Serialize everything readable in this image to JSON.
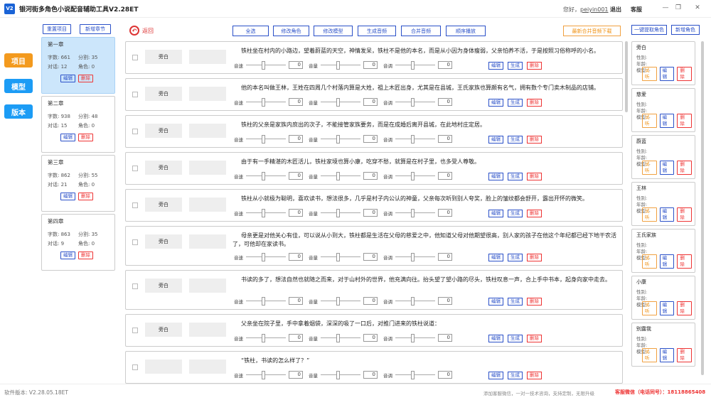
{
  "app": {
    "logo": "V2",
    "title": "银河街多角色小说配音辅助工具V2.28ET",
    "greeting": "您好，",
    "username": "peiyin001",
    "logout": "退出",
    "service": "客服"
  },
  "nav": {
    "items": [
      {
        "label": "项目",
        "color": "#f39a1e"
      },
      {
        "label": "模型",
        "color": "#1c9cf5"
      },
      {
        "label": "版本",
        "color": "#1c9cf5"
      }
    ]
  },
  "chapter_panel": {
    "reset": "重置项目",
    "add": "新增章节",
    "chapters": [
      {
        "title": "第一章",
        "chars_label": "字数:",
        "chars": "661",
        "lines_label": "分割:",
        "lines": "35",
        "dialog_label": "对话:",
        "dialog": "12",
        "roles_label": "角色:",
        "roles": "0",
        "edit": "编辑",
        "del": "删除"
      },
      {
        "title": "第二章",
        "chars_label": "字数:",
        "chars": "938",
        "lines_label": "分割:",
        "lines": "48",
        "dialog_label": "对话:",
        "dialog": "15",
        "roles_label": "角色:",
        "roles": "0",
        "edit": "编辑",
        "del": "删除"
      },
      {
        "title": "第三章",
        "chars_label": "字数:",
        "chars": "862",
        "lines_label": "分割:",
        "lines": "55",
        "dialog_label": "对话:",
        "dialog": "21",
        "roles_label": "角色:",
        "roles": "0",
        "edit": "编辑",
        "del": "删除"
      },
      {
        "title": "第四章",
        "chars_label": "字数:",
        "chars": "863",
        "lines_label": "分割:",
        "lines": "35",
        "dialog_label": "对话:",
        "dialog": "9",
        "roles_label": "角色:",
        "roles": "0",
        "edit": "编辑",
        "del": "删除"
      }
    ]
  },
  "toolbar": {
    "back": "返回",
    "select_all": "全选",
    "edit_role": "修改角色",
    "edit_model": "修改模型",
    "gen_audio": "生成音频",
    "merge_audio": "合并音频",
    "play_seq": "顺序播放",
    "download": "最新合并音频下载"
  },
  "controls": {
    "speed": "音速",
    "volume": "音量",
    "pitch": "音调",
    "speed_val": "0",
    "volume_val": "0",
    "pitch_val": "0",
    "edit": "编辑",
    "gen": "生成",
    "del": "删除"
  },
  "lines": [
    {
      "role": "旁白",
      "text": "铁柱坐在村内的小路边，望着蔚蓝的天空，神情发呆，铁柱不是他的本名，而是从小因为身体瘦弱，父亲怕养不活，于是按照习俗称呼的小名。"
    },
    {
      "role": "旁白",
      "text": "他的本名叫做王林，王姓在四周几个村落内算是大姓，祖上木匠出身，尤其是在县城，王氏家族也算颇有名气，拥有数个专门卖木制品的店铺。"
    },
    {
      "role": "旁白",
      "text": "铁柱的父亲是家族内庶出的次子，不能接管家族要务，而是在成婚后离开县城，在此地村庄定居。"
    },
    {
      "role": "旁白",
      "text": "由于有一手精湛的木匠活儿，铁柱家境也算小康，吃穿不愁，就算是在村子里，也多受人尊敬。"
    },
    {
      "role": "旁白",
      "text": "铁柱从小就极为聪明，喜欢读书，想法很多，几乎是村子内公认的神童，父亲每次听到别人夸奖，脸上的皱纹都会舒开，露出开怀的微笑。"
    },
    {
      "role": "旁白",
      "text": "母亲更是对他关心有佳，可以说从小到大，铁柱都是生活在父母的慈爱之中，他知道父母对他期望很高，别人家的孩子在他这个年纪都已经下地干农活了，可他却在家读书。"
    },
    {
      "role": "旁白",
      "text": "书读的多了，想法自然也就随之而来，对于山村外的世界，他充满向往。抬头望了望小路的尽头，铁柱叹息一声，合上手中书本，起身向家中走去。"
    },
    {
      "role": "旁白",
      "text": "父亲坐在院子里，手中拿着烟袋，深深的吸了一口后，对推门进来的铁柱说道："
    },
    {
      "role": "",
      "text": "“铁柱，书读的怎么样了？”"
    }
  ],
  "role_panel": {
    "extract": "一键提取角色",
    "add": "新增角色",
    "gender_label": "性别:",
    "age_label": "年龄:",
    "model_label": "模型:",
    "dash": "-",
    "trial": "试听",
    "edit": "编辑",
    "del": "删除",
    "roles": [
      "旁白",
      "慈爱",
      "蔚蓝",
      "王林",
      "王氏家族",
      "小康",
      "别露我"
    ]
  },
  "footer": {
    "version": "软件版本: V2.28.05.18ET",
    "contact": "添加客服微信，一对一技术咨询，支持定制，无限升级",
    "phone": "客服微信（电话同号）：18118865408"
  },
  "colors": {
    "accent": "#2a50c8",
    "danger": "#e33",
    "orange": "#f09010",
    "active_chapter": "#cce6fb"
  }
}
